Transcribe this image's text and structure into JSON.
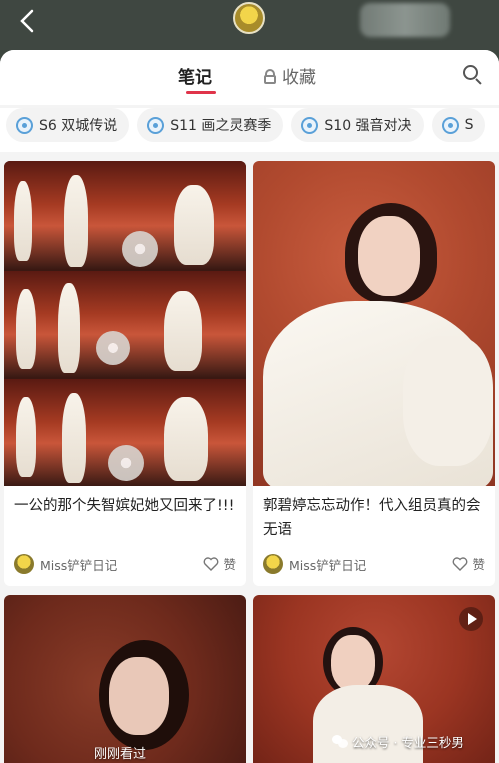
{
  "header": {
    "back_label": "‹"
  },
  "tabs": {
    "notes": "笔记",
    "favorites": "收藏"
  },
  "chips": [
    {
      "label": "S6 双城传说"
    },
    {
      "label": "S11 画之灵赛季"
    },
    {
      "label": "S10 强音对决"
    },
    {
      "label": "S"
    }
  ],
  "feed": [
    {
      "title": "一公的那个失智嫔妃她又回来了!!!",
      "author": "Miss铲铲日记",
      "like": "赞"
    },
    {
      "title": "郭碧婷忘忘动作！代入组员真的会无语",
      "author": "Miss铲铲日记",
      "like": "赞"
    },
    {
      "caption": "刚刚看过"
    },
    {
      "has_video": true
    }
  ],
  "watermark": "公众号 · 专业三秒男",
  "colors": {
    "accent": "#e0344a",
    "chip_icon": "#5aa0d8"
  }
}
